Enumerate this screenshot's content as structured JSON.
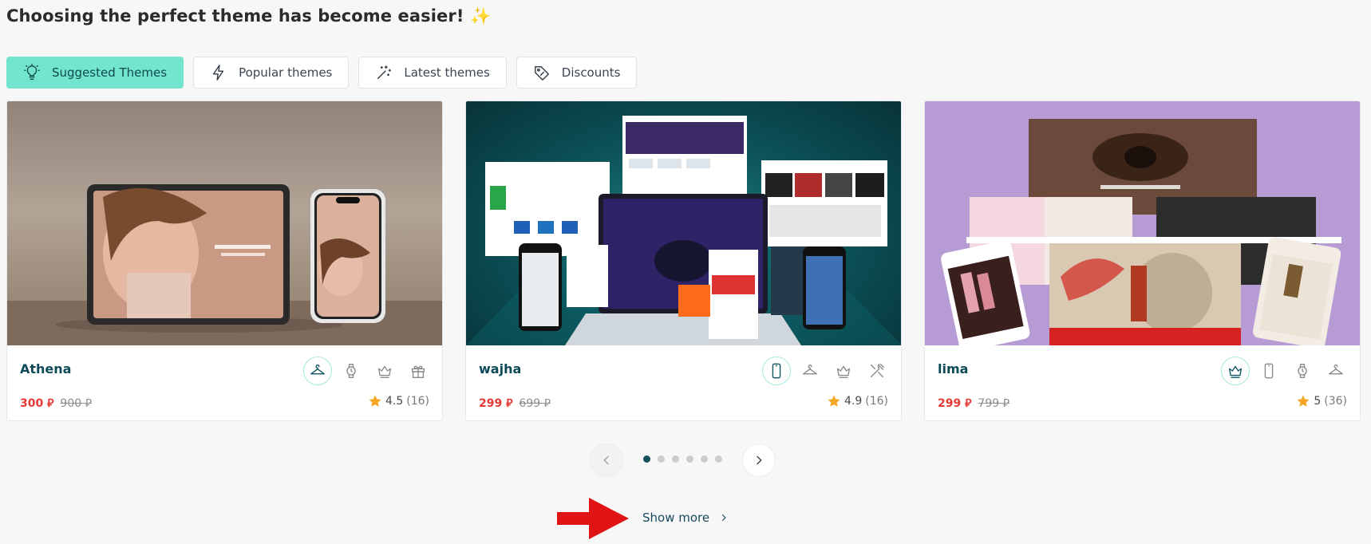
{
  "heading": "Choosing the perfect theme has become easier! ✨",
  "tabs": [
    {
      "label": "Suggested Themes",
      "icon": "lightbulb-icon",
      "active": true
    },
    {
      "label": "Popular themes",
      "icon": "lightning-icon",
      "active": false
    },
    {
      "label": "Latest themes",
      "icon": "magic-wand-icon",
      "active": false
    },
    {
      "label": "Discounts",
      "icon": "price-tag-icon",
      "active": false
    }
  ],
  "cards": [
    {
      "name": "Athena",
      "price": "300 ⃁",
      "old_price": "900 ⃁",
      "rating": "4.5",
      "reviews": "(16)",
      "icons": [
        "hanger-icon",
        "watch-icon",
        "crown-icon",
        "gift-icon"
      ]
    },
    {
      "name": "wajha",
      "price": "299 ⃁",
      "old_price": "699 ⃁",
      "rating": "4.9",
      "reviews": "(16)",
      "icons": [
        "phone-icon",
        "hanger-icon",
        "crown-icon",
        "utensils-icon"
      ]
    },
    {
      "name": "lima",
      "price": "299 ⃁",
      "old_price": "799 ⃁",
      "rating": "5",
      "reviews": "(36)",
      "icons": [
        "crown-icon",
        "phone-icon",
        "watch-icon",
        "hanger-icon"
      ]
    }
  ],
  "carousel": {
    "pages": 6,
    "current": 1
  },
  "show_more": "Show more",
  "colors": {
    "accent": "#73e5cf",
    "price": "#e53935",
    "star": "#f5a623",
    "title": "#0d4a57"
  }
}
